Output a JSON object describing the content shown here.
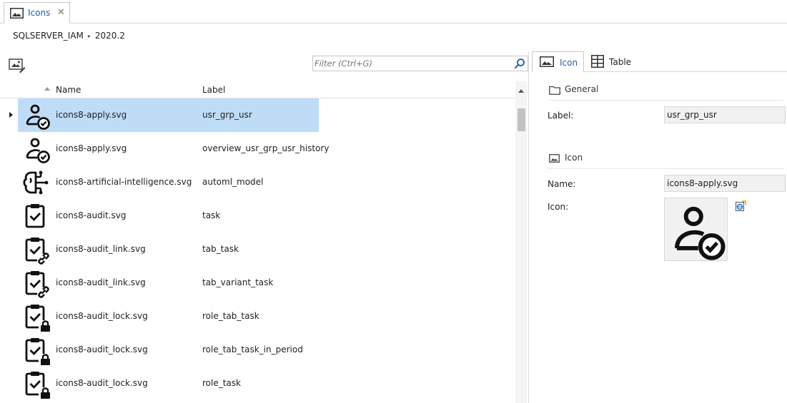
{
  "tab": {
    "label": "Icons",
    "close": "✕",
    "icon": "image-icon"
  },
  "breadcrumb": {
    "db": "SQLSERVER_IAM",
    "separator": "▸",
    "version": "2020.2"
  },
  "toolbar": {
    "icon": "edit-image-icon"
  },
  "filter": {
    "placeholder": "Filter (Ctrl+G)",
    "icon": "search-icon"
  },
  "grid": {
    "headers": {
      "name": "Name",
      "label": "Label"
    },
    "rows": [
      {
        "name": "icons8-apply.svg",
        "label": "usr_grp_usr",
        "icon": "user-check-icon",
        "selected": true
      },
      {
        "name": "icons8-apply.svg",
        "label": "overview_usr_grp_usr_history",
        "icon": "user-check-icon"
      },
      {
        "name": "icons8-artificial-intelligence.svg",
        "label": "automl_model",
        "icon": "artificial-intelligence-icon"
      },
      {
        "name": "icons8-audit.svg",
        "label": "task",
        "icon": "clipboard-check-icon"
      },
      {
        "name": "icons8-audit_link.svg",
        "label": "tab_task",
        "icon": "clipboard-check-link-icon"
      },
      {
        "name": "icons8-audit_link.svg",
        "label": "tab_variant_task",
        "icon": "clipboard-check-link-icon"
      },
      {
        "name": "icons8-audit_lock.svg",
        "label": "role_tab_task",
        "icon": "clipboard-check-lock-icon"
      },
      {
        "name": "icons8-audit_lock.svg",
        "label": "role_tab_task_in_period",
        "icon": "clipboard-check-lock-icon"
      },
      {
        "name": "icons8-audit_lock.svg",
        "label": "role_task",
        "icon": "clipboard-check-lock-icon"
      }
    ]
  },
  "right": {
    "tabs": [
      {
        "label": "Icon",
        "icon": "image-icon",
        "active": true
      },
      {
        "label": "Table",
        "icon": "table-icon",
        "active": false
      }
    ],
    "general": {
      "title": "General",
      "icon": "folder-icon",
      "label_caption": "Label:",
      "label_value": "usr_grp_usr"
    },
    "icon_section": {
      "title": "Icon",
      "icon": "image-icon",
      "name_caption": "Name:",
      "name_value": "icons8-apply.svg",
      "icon_caption": "Icon:",
      "preview_icon": "user-check-icon",
      "edit_icon": "edit-browser-icon"
    }
  },
  "colors": {
    "accent": "#1d5fa8",
    "selection": "#bfdcf7"
  }
}
